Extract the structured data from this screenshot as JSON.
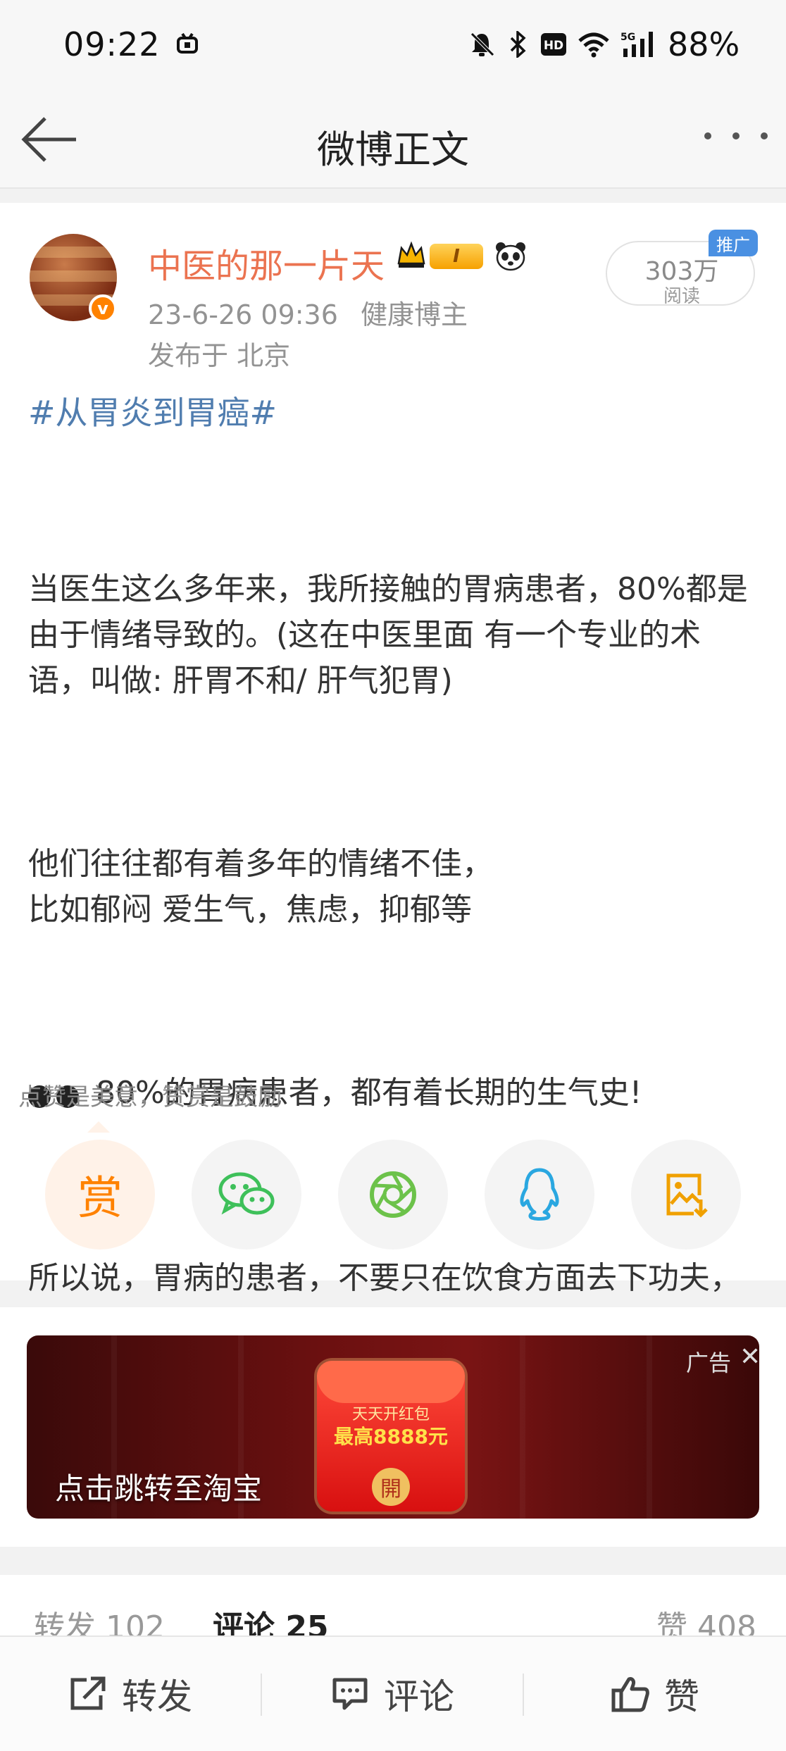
{
  "status_bar": {
    "time": "09:22",
    "battery": "88%",
    "icons": [
      "media-icon",
      "mute-icon",
      "bluetooth-icon",
      "hd-icon",
      "wifi-icon",
      "signal-5g-icon"
    ]
  },
  "nav": {
    "title": "微博正文"
  },
  "post": {
    "username": "中医的那一片天",
    "level": "I",
    "date": "23-6-26 09:36",
    "author_tag": "健康博主",
    "location": "发布于 北京",
    "read_count": "303万",
    "read_label": "阅读",
    "promo_tag": "推广",
    "hashtag": "#从胃炎到胃癌#",
    "paragraphs": [
      "当医生这么多年来，我所接触的胃病患者，80%都是由于情绪导致的。(这在中医里面 有一个专业的术语，叫做: 肝胃不和/ 肝气犯胃)",
      "他们往往都有着多年的情绪不佳，\n比如郁闷 爱生气，焦虑，抑郁等",
      "80%的胃病患者，都有着长期的生气史!",
      "所以说，胃病的患者，不要只在饮食方面去下功夫，更重要的是调节情绪，保持心情愉快，少生气，少郁闷，少焦虑，这才是“治本”之法。"
    ]
  },
  "reward": {
    "prompt": "点赞是美意，赞赏是鼓励",
    "reward_label": "赏",
    "share_icons": [
      "wechat-icon",
      "moments-icon",
      "qq-icon",
      "save-image-icon"
    ]
  },
  "ad": {
    "caption": "点击跳转至淘宝",
    "badge": "广告",
    "close": "✕",
    "bag_line1": "天天开红包",
    "bag_line2": "最高8888元",
    "bag_seal": "開"
  },
  "stats": {
    "forward": "转发 102",
    "comments": "评论 25",
    "likes": "赞 408"
  },
  "actions": {
    "forward": "转发",
    "comment": "评论",
    "like": "赞"
  },
  "colors": {
    "username": "#eb7350",
    "hashtag": "#507daf",
    "accent": "#ff8200",
    "promo": "#4a90e2"
  }
}
